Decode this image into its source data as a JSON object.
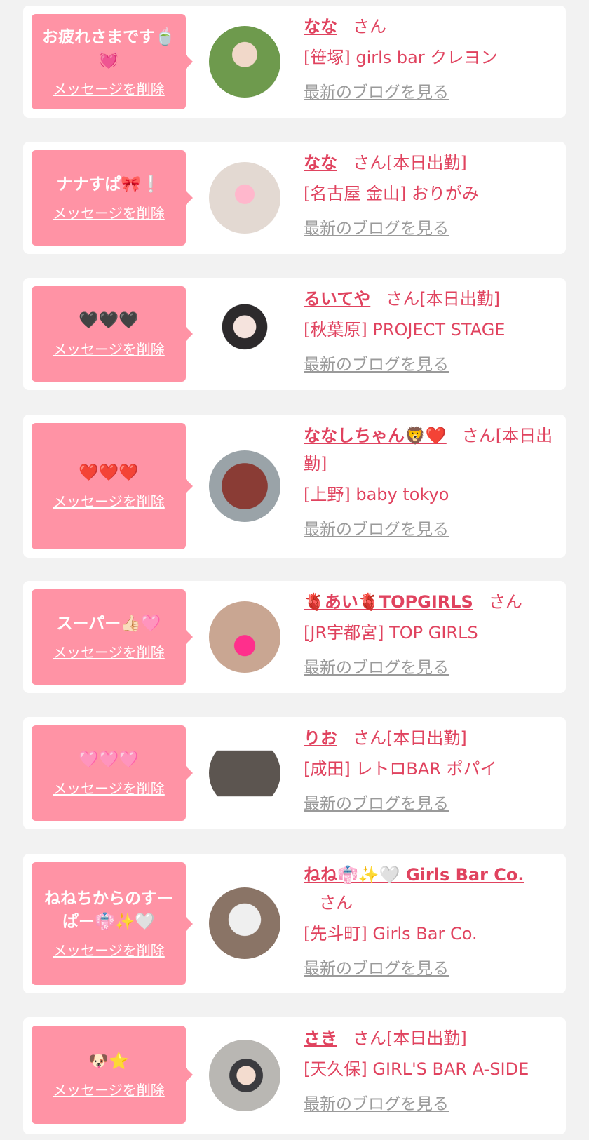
{
  "entries": [
    {
      "message": "お疲れさまです🍵💓",
      "delete_label": "メッセージを削除",
      "name": "なな",
      "suffix": "さん",
      "shop": "[笹塚] girls bar クレヨン",
      "blog_label": "最新のブログを見る",
      "avatar_color": "#6e9a4d"
    },
    {
      "message": "ナナすぱ🎀❕",
      "delete_label": "メッセージを削除",
      "name": "なな",
      "suffix": "さん[本日出勤]",
      "shop": "[名古屋 金山] おりがみ",
      "blog_label": "最新のブログを見る",
      "avatar_color": "#e3d9d2"
    },
    {
      "message": "🖤🖤🖤",
      "delete_label": "メッセージを削除",
      "name": "るいてや",
      "suffix": "さん[本日出勤]",
      "shop": "[秋葉原] PROJECT STAGE",
      "blog_label": "最新のブログを見る",
      "avatar_color": "#d8c8c2"
    },
    {
      "message": "❤️❤️❤️",
      "delete_label": "メッセージを削除",
      "name": "ななしちゃん🦁❤️",
      "suffix": "さん[本日出勤]",
      "shop": "[上野] baby tokyo",
      "blog_label": "最新のブログを見る",
      "avatar_color": "#8a3c35"
    },
    {
      "message": "スーパー👍🏻🩷",
      "delete_label": "メッセージを削除",
      "name": "🫀あい🫀TOPGIRLS",
      "suffix": "さん",
      "shop": "[JR宇都宮] TOP GIRLS",
      "blog_label": "最新のブログを見る",
      "avatar_color": "#c9a692"
    },
    {
      "message": "🩷🩷🩷",
      "delete_label": "メッセージを削除",
      "name": "りお",
      "suffix": "さん[本日出勤]",
      "shop": "[成田] レトロBAR ポパイ",
      "blog_label": "最新のブログを見る",
      "avatar_color": "#5c5550"
    },
    {
      "message": "ねねちからのすーぱー👘✨🤍",
      "delete_label": "メッセージを削除",
      "name": "ねね👘✨🤍 Girls Bar Co.",
      "suffix": "さん",
      "shop": "[先斗町] Girls Bar Co.",
      "blog_label": "最新のブログを見る",
      "avatar_color": "#8a7466"
    },
    {
      "message": "🐶⭐",
      "delete_label": "メッセージを削除",
      "name": "さき",
      "suffix": "さん[本日出勤]",
      "shop": "[天久保] GIRL'S BAR A-SIDE",
      "blog_label": "最新のブログを見る",
      "avatar_color": "#b9b7b3"
    }
  ],
  "colors": {
    "bubble": "#ff93a5",
    "accent": "#e0435f",
    "link_gray": "#9a9a9a",
    "background": "#f2f2f2"
  }
}
